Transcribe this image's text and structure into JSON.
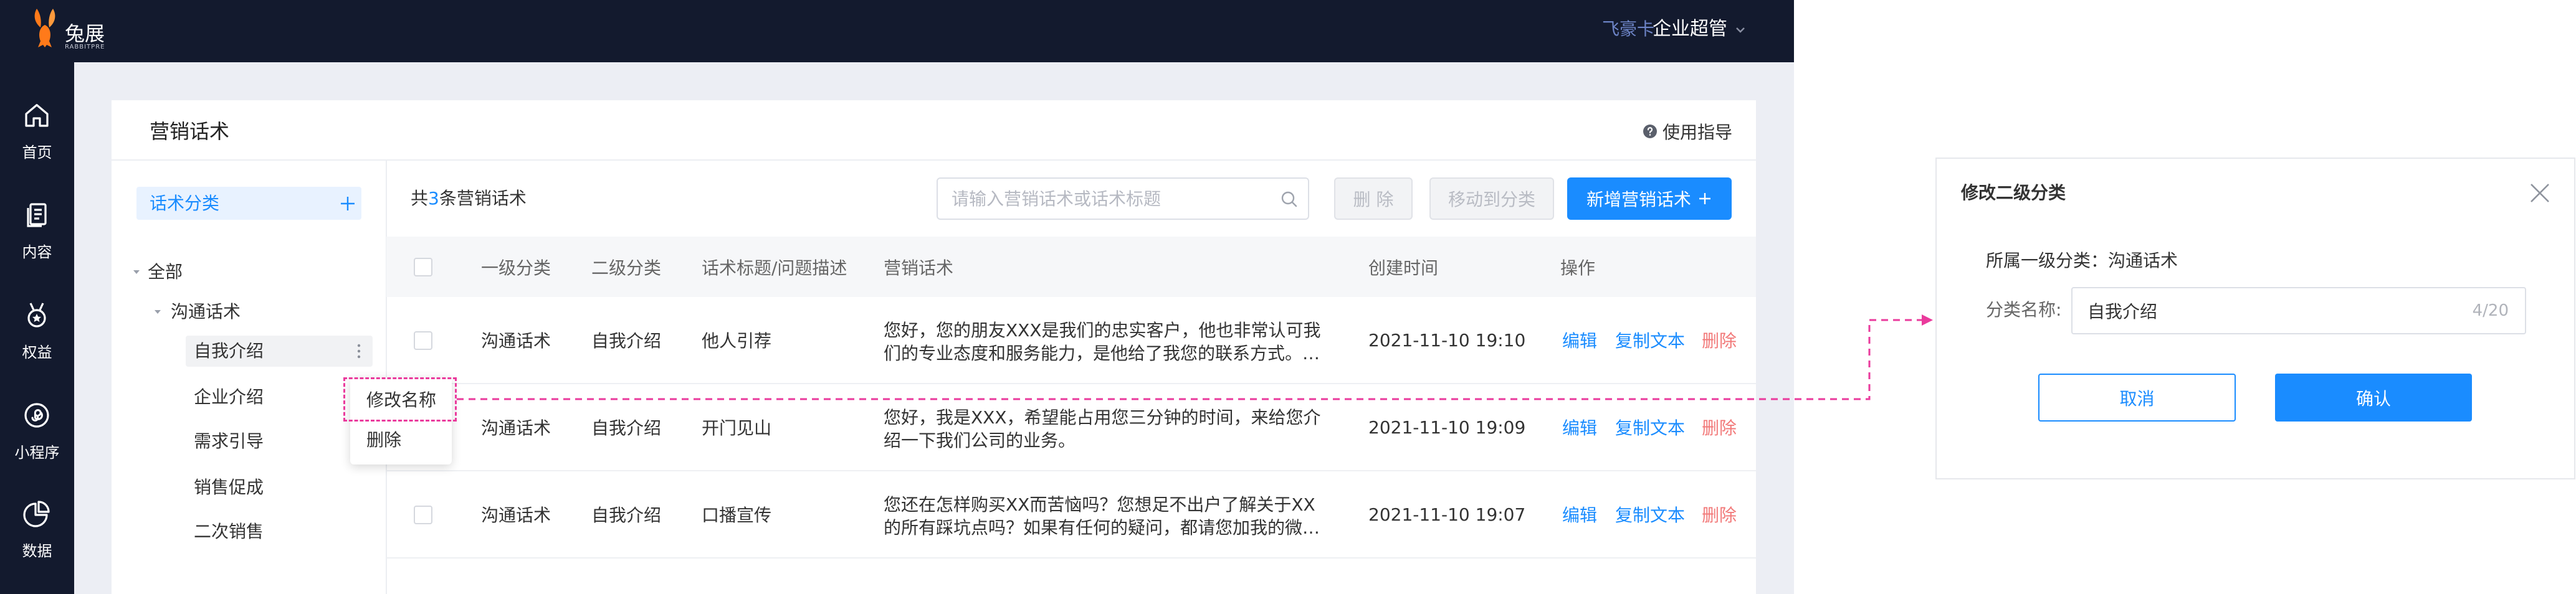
{
  "header": {
    "brand": "兔展",
    "brand_sub": "RABBITPRE",
    "logo_icon": "rabbit-logo",
    "account_tag": "飞豪卡",
    "user_role": "企业超管",
    "user_menu_icon": "chevron-down-icon"
  },
  "sidebar": {
    "items": [
      {
        "label": "首页",
        "icon": "home-icon"
      },
      {
        "label": "内容",
        "icon": "document-icon"
      },
      {
        "label": "权益",
        "icon": "medal-icon"
      },
      {
        "label": "小程序",
        "icon": "mini-program-icon"
      },
      {
        "label": "数据",
        "icon": "pie-chart-icon"
      }
    ]
  },
  "page": {
    "title": "营销话术",
    "help_label": "使用指导",
    "help_icon": "question-circle-icon"
  },
  "category_panel": {
    "title": "话术分类",
    "add_icon": "plus-icon",
    "tree": {
      "root": "全部",
      "group": "沟通话术",
      "children": [
        "自我介绍",
        "企业介绍",
        "需求引导",
        "销售促成",
        "二次销售"
      ],
      "selected_index": 0,
      "more_icon": "more-vertical-icon"
    }
  },
  "context_menu": {
    "items": [
      "修改名称",
      "删除"
    ]
  },
  "toolbar": {
    "count_prefix": "共",
    "count": "3",
    "count_suffix": "条营销话术",
    "search_placeholder": "请输入营销话术或话术标题",
    "search_icon": "search-icon",
    "delete_label": "删 除",
    "move_label": "移动到分类",
    "add_label": "新增营销话术",
    "add_icon": "plus-icon"
  },
  "table": {
    "columns": {
      "level1": "一级分类",
      "level2": "二级分类",
      "title": "话术标题/问题描述",
      "content": "营销话术",
      "created": "创建时间",
      "ops": "操作"
    },
    "rows": [
      {
        "level1": "沟通话术",
        "level2": "自我介绍",
        "title": "他人引荐",
        "content": "您好，您的朋友XXX是我们的忠实客户，他也非常认可我们的专业态度和服务能力，是他给了我您的联系方式。…",
        "created": "2021-11-10 19:10"
      },
      {
        "level1": "沟通话术",
        "level2": "自我介绍",
        "title": "开门见山",
        "content": "您好，我是XXX，希望能占用您三分钟的时间，来给您介绍一下我们公司的业务。",
        "created": "2021-11-10 19:09"
      },
      {
        "level1": "沟通话术",
        "level2": "自我介绍",
        "title": "口播宣传",
        "content": "您还在怎样购买XX而苦恼吗？您想足不出户了解关于XX的所有踩坑点吗？如果有任何的疑问，都请您加我的微…",
        "created": "2021-11-10 19:07"
      }
    ],
    "actions": {
      "edit": "编辑",
      "copy": "复制文本",
      "delete": "删除"
    }
  },
  "dialog": {
    "title": "修改二级分类",
    "close_icon": "close-icon",
    "parent_label": "所属一级分类：",
    "parent_value": "沟通话术",
    "name_label": "分类名称:",
    "name_value": "自我介绍",
    "name_counter": "4/20",
    "cancel_label": "取消",
    "confirm_label": "确认"
  },
  "colors": {
    "primary": "#1a8cff",
    "danger": "#f27a7a",
    "topbar": "#131a2e",
    "page_bg": "#eceef4",
    "annotation": "#ea3a9c",
    "logo": "#ff7a1a"
  }
}
